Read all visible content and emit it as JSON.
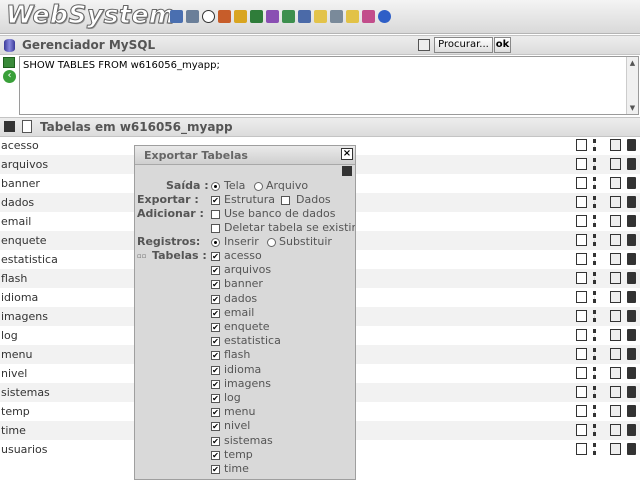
{
  "app": {
    "title": "WebSystem"
  },
  "toolbar": {
    "icons": [
      "users-icon",
      "wrench-icon",
      "radio-icon",
      "person-icon",
      "lock-icon",
      "books-icon",
      "chart-icon",
      "window-icon",
      "table-icon",
      "folder-icon",
      "copy-icon",
      "mail-icon",
      "paint-icon",
      "help-icon"
    ]
  },
  "mysql": {
    "header_title": "Gerenciador MySQL",
    "search_label": "Procurar...",
    "ok_label": "ok",
    "query": "SHOW TABLES FROM w616056_myapp;"
  },
  "tables_section": {
    "title": "Tabelas em w616056_myapp"
  },
  "tables": [
    {
      "name": "acesso"
    },
    {
      "name": "arquivos"
    },
    {
      "name": "banner"
    },
    {
      "name": "dados"
    },
    {
      "name": "email"
    },
    {
      "name": "enquete"
    },
    {
      "name": "estatistica"
    },
    {
      "name": "flash"
    },
    {
      "name": "idioma"
    },
    {
      "name": "imagens"
    },
    {
      "name": "log"
    },
    {
      "name": "menu"
    },
    {
      "name": "nivel"
    },
    {
      "name": "sistemas"
    },
    {
      "name": "temp"
    },
    {
      "name": "time"
    },
    {
      "name": "usuarios"
    }
  ],
  "export_dialog": {
    "title": "Exportar Tabelas",
    "close_label": "×",
    "saida_label": "Saída :",
    "saida_tela": "Tela",
    "saida_arquivo": "Arquivo",
    "exportar_label": "Exportar :",
    "exportar_estrutura": "Estrutura",
    "exportar_dados": "Dados",
    "adicionar_label": "Adicionar :",
    "adicionar_usar": "Use banco de dados",
    "adicionar_deletar": "Deletar tabela se existir",
    "registros_label": "Registros:",
    "registros_inserir": "Inserir",
    "registros_substituir": "Substituir",
    "tabelas_label": "Tabelas :",
    "tabelas": [
      "acesso",
      "arquivos",
      "banner",
      "dados",
      "email",
      "enquete",
      "estatistica",
      "flash",
      "idioma",
      "imagens",
      "log",
      "menu",
      "nivel",
      "sistemas",
      "temp",
      "time"
    ]
  }
}
